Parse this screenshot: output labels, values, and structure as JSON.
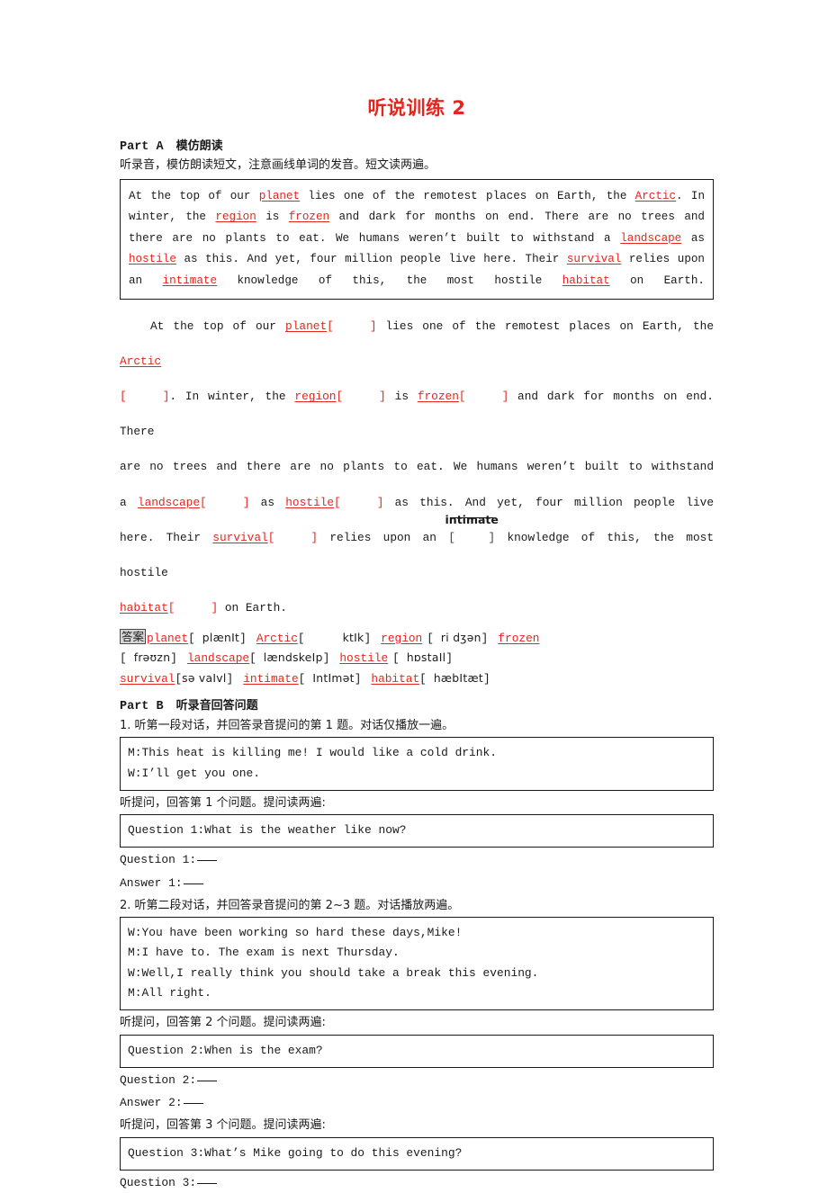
{
  "document": {
    "title": "听说训练 2",
    "title_color": "#e8251d",
    "keyword_color": "#e8251d"
  },
  "part_a": {
    "label": "Part A",
    "title": "模仿朗读",
    "instruction": "听录音，模仿朗读短文，注意画线单词的发音。短文读两遍。",
    "passage_segments": [
      {
        "t": "At the top of our ",
        "k": false
      },
      {
        "t": "planet",
        "k": true
      },
      {
        "t": " lies one of the remotest places on Earth, the ",
        "k": false
      },
      {
        "t": "Arctic",
        "k": true
      },
      {
        "t": ". In winter, the ",
        "k": false
      },
      {
        "t": "region",
        "k": true
      },
      {
        "t": " is ",
        "k": false
      },
      {
        "t": "frozen",
        "k": true
      },
      {
        "t": " and dark for months on end. There are no trees and there are no plants to eat. We humans weren’t built to withstand a ",
        "k": false
      },
      {
        "t": "landscape",
        "k": true
      },
      {
        "t": " as ",
        "k": false
      },
      {
        "t": "hostile",
        "k": true
      },
      {
        "t": " as this. And yet, four million people live here. Their ",
        "k": false
      },
      {
        "t": "survival",
        "k": true
      },
      {
        "t": " relies upon an ",
        "k": false
      },
      {
        "t": "intimate",
        "k": true
      },
      {
        "t": " knowledge of this, the most hostile ",
        "k": false
      },
      {
        "t": "habitat",
        "k": true
      },
      {
        "t": " on Earth.",
        "k": false
      }
    ],
    "cloze": {
      "line1_pre": "At the top of our ",
      "line1_kw": "planet",
      "line1_mid": " lies one of the remotest places on Earth, the ",
      "line1_kw2": "Arctic",
      "line2_pre": ". In winter, the ",
      "line2_kw": "region",
      "line2_mid": " is ",
      "line2_kw2": "frozen",
      "line2_post": " and dark for months on end. There",
      "line3": "are no trees and there are no plants to eat. We humans weren’t built to withstand",
      "line4_pre": "a ",
      "line4_kw": "landscape",
      "line4_mid": " as ",
      "line4_kw2": "hostile",
      "line4_post": " as this. And yet, four million people live",
      "line5_pre": "here. Their ",
      "line5_kw": "survival",
      "line5_mid": " relies upon an ",
      "line5_anno": "intimate",
      "line5_post": " knowledge of this, the most hostile",
      "line6_kw": "habitat",
      "line6_post": " on Earth.",
      "bracket_open": "[",
      "bracket_close": "]"
    },
    "answer": {
      "badge": "答案",
      "entries": [
        {
          "word": "planet",
          "ipa": "plænIt"
        },
        {
          "word": "Arctic",
          "ipa": "ktIk"
        },
        {
          "word": "region",
          "ipa": "ri dʒən"
        },
        {
          "word": "frozen",
          "ipa": "frəʊzn"
        },
        {
          "word": "landscape",
          "ipa": "lændskeIp"
        },
        {
          "word": "hostile",
          "ipa": "hɒstaIl"
        },
        {
          "word": "survival",
          "ipa": "sə vaIvl"
        },
        {
          "word": "intimate",
          "ipa": "IntImət"
        },
        {
          "word": "habitat",
          "ipa": "hæbItæt"
        }
      ]
    }
  },
  "part_b": {
    "label": "Part B",
    "title": "听录音回答问题",
    "item1": {
      "instruction": "1. 听第一段对话，并回答录音提问的第 1 题。对话仅播放一遍。",
      "dialogue": [
        "M:This heat is killing me! I would like a cold drink.",
        "W:I’ll get you one."
      ],
      "prompt": "听提问，回答第 1 个问题。提问读两遍:",
      "question_box": "Question 1:What is the weather like now?",
      "answer_rows": [
        {
          "label": "Question 1:"
        },
        {
          "label": "Answer 1:"
        }
      ]
    },
    "item2": {
      "instruction": "2. 听第二段对话，并回答录音提问的第 2~3 题。对话播放两遍。",
      "dialogue": [
        "W:You have been working so hard these days,Mike!",
        "M:I have to. The exam is next Thursday.",
        "W:Well,I really think you should take a break this evening.",
        "M:All right."
      ],
      "prompt2": "听提问，回答第 2 个问题。提问读两遍:",
      "question_box2": "Question 2:When is the exam?",
      "answer_rows2": [
        {
          "label": "Question 2:"
        },
        {
          "label": "Answer 2:"
        }
      ],
      "prompt3": "听提问，回答第 3 个问题。提问读两遍:",
      "question_box3": "Question 3:What’s Mike going to do this evening?",
      "answer_rows3": [
        {
          "label": "Question 3:"
        }
      ]
    }
  }
}
